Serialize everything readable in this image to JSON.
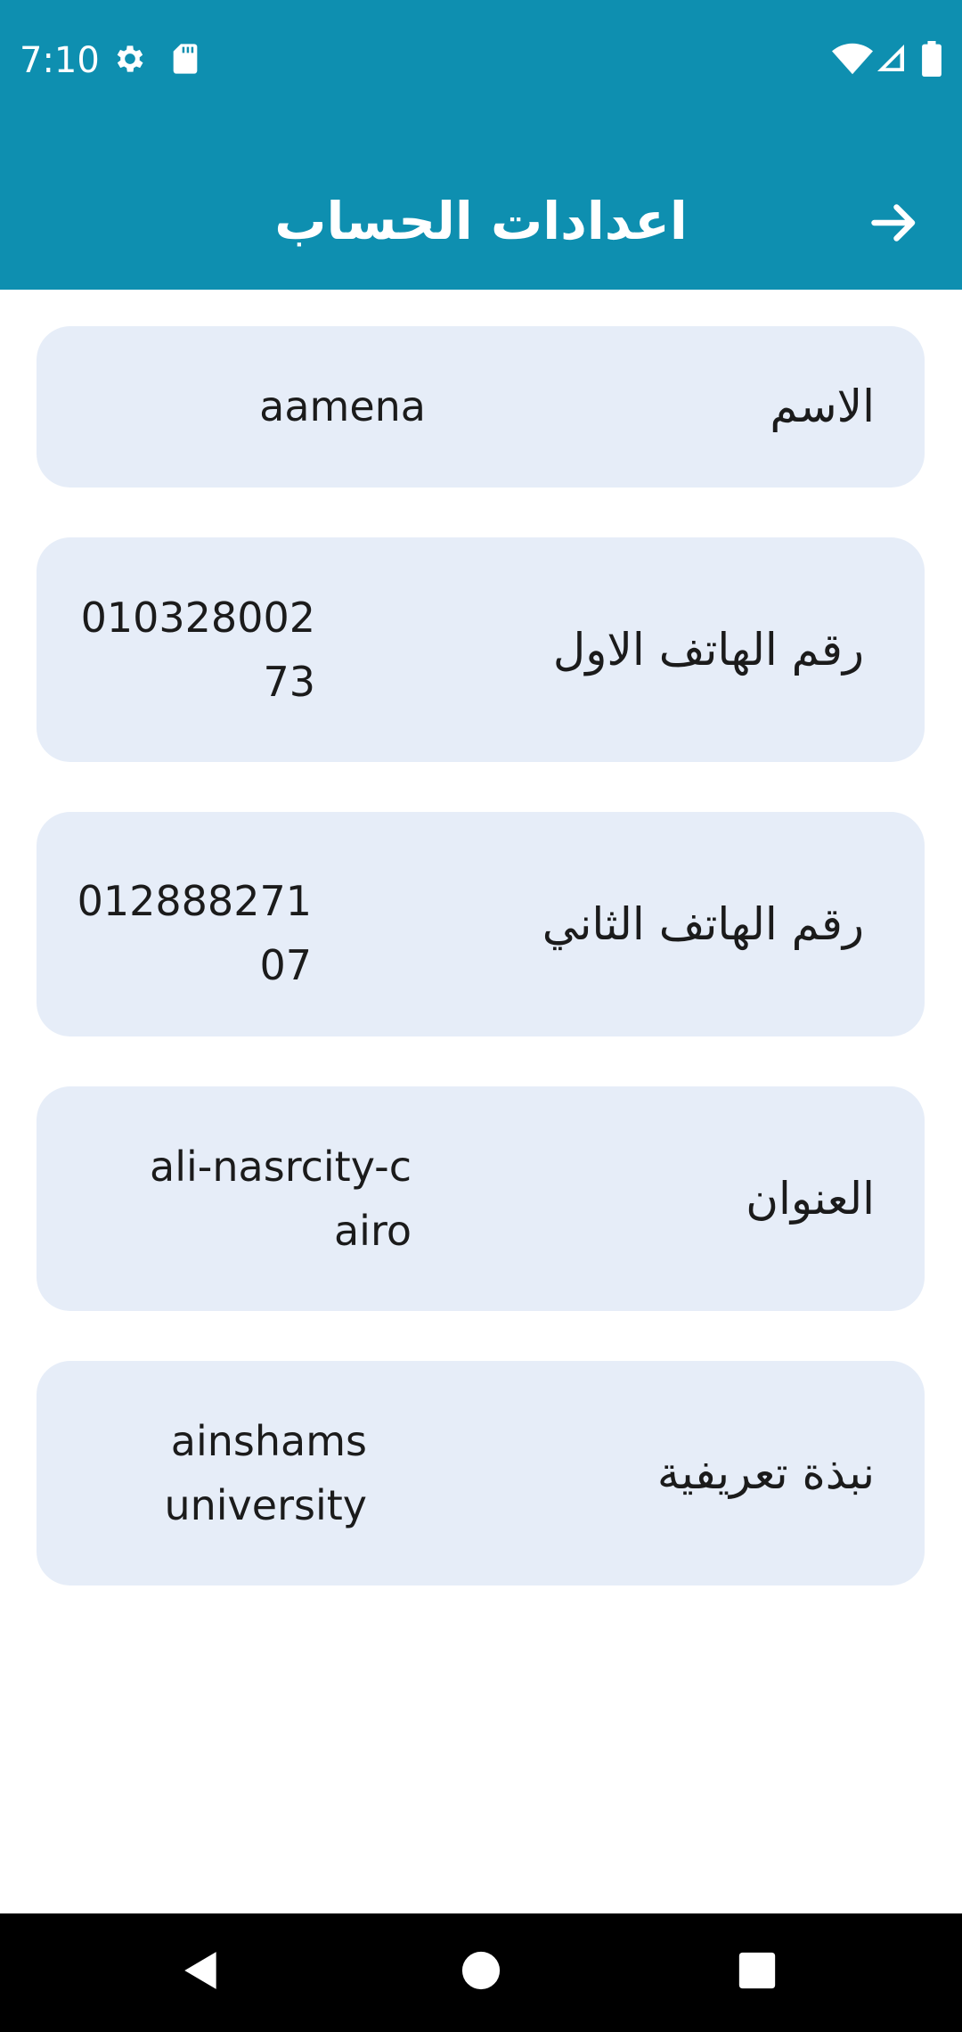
{
  "status_bar": {
    "time": "7:10",
    "icons_left": [
      "gear-icon",
      "sd-card-icon"
    ],
    "icons_right": [
      "wifi-icon",
      "signal-icon",
      "battery-icon"
    ]
  },
  "app_bar": {
    "title": "اعدادات الحساب",
    "back_icon": "arrow-right-icon"
  },
  "fields": [
    {
      "label": "الاسم",
      "value": "aamena"
    },
    {
      "label": "رقم الهاتف الاول",
      "value": "01032800273"
    },
    {
      "label": "رقم الهاتف الثاني",
      "value": "01288827107"
    },
    {
      "label": "العنوان",
      "value": "ali-nasrcity-cairo"
    },
    {
      "label": "نبذة تعريفية",
      "value": "ainshams university"
    }
  ],
  "nav_bar": {
    "buttons": [
      "back-triangle-icon",
      "home-circle-icon",
      "recents-square-icon"
    ]
  },
  "colors": {
    "primary": "#0e8fb0",
    "card_background": "#e6edf8",
    "text": "#1b1b1b"
  }
}
